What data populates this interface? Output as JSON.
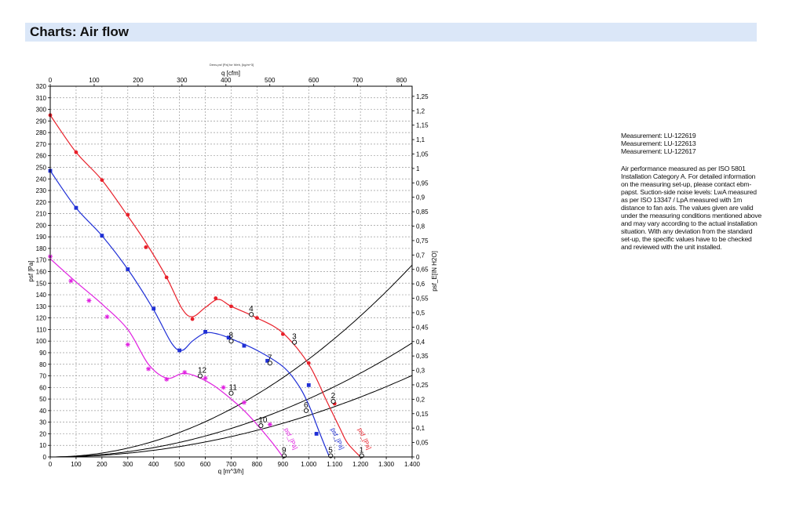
{
  "header": {
    "title": "Charts: Air flow"
  },
  "notes": {
    "measurements": [
      "Measurement: LU-122619",
      "Measurement: LU-122613",
      "Measurement: LU-122617"
    ],
    "description": "Air performance measured as per ISO 5801 Installation Category A. For detailed information on the measuring set-up, please contact ebm-papst. Suction-side noise levels: LwA measured as per ISO 13347 / LpA measured with 1m distance to fan axis. The values given are valid under the measuring conditions mentioned above and may vary according to the actual installation situation. With any deviation from the standard set-up, the specific values have to be checked and reviewed with the unit installed."
  },
  "colors": {
    "red": "#e8202a",
    "blue": "#1f2fd6",
    "magenta": "#e020e0",
    "system": "#000000",
    "grid": "#9a9a9a",
    "header_bg": "#dbe7f8"
  },
  "chart_data": {
    "type": "line",
    "title": "Dens.psf [Pa] for Weh, [kg/m^3]",
    "xlabel": "q [m^3/h]",
    "x_ticks": [
      "0",
      "100",
      "200",
      "300",
      "400",
      "500",
      "600",
      "700",
      "800",
      "900",
      "1.000",
      "1.100",
      "1.200",
      "1.300",
      "1.400"
    ],
    "xlim": [
      0,
      1400
    ],
    "x2label": "q [cfm]",
    "x2_ticks": [
      "0",
      "100",
      "200",
      "300",
      "400",
      "500",
      "600",
      "700",
      "800"
    ],
    "x2lim": [
      0,
      824
    ],
    "ylabel": "psf [Pa]",
    "ylim": [
      0,
      320
    ],
    "y_ticks": [
      "0",
      "10",
      "20",
      "30",
      "40",
      "50",
      "60",
      "70",
      "80",
      "90",
      "100",
      "110",
      "120",
      "130",
      "140",
      "150",
      "160",
      "170",
      "180",
      "190",
      "200",
      "210",
      "220",
      "230",
      "240",
      "250",
      "260",
      "270",
      "280",
      "290",
      "300",
      "310",
      "320"
    ],
    "y2label": "psf_E[IN H2O]",
    "y2lim": [
      0,
      1.285
    ],
    "y2_ticks": [
      "0",
      "0,05",
      "0,1",
      "0,15",
      "0,2",
      "0,25",
      "0,3",
      "0,35",
      "0,4",
      "0,45",
      "0,5",
      "0,55",
      "0,6",
      "0,65",
      "0,7",
      "0,75",
      "0,8",
      "0,85",
      "0,9",
      "0,95",
      "1",
      "1,05",
      "1,1",
      "1,15",
      "1,2",
      "1,25"
    ],
    "grid": true,
    "series": [
      {
        "name": "psf [Pa]",
        "color": "red",
        "marker": "circle",
        "x": [
          0,
          100,
          200,
          300,
          370,
          450,
          510,
          550,
          600,
          650,
          700,
          800,
          900,
          1000,
          1070,
          1120,
          1150,
          1200
        ],
        "y": [
          295,
          263,
          239,
          208,
          185,
          155,
          128,
          121,
          129,
          136,
          130,
          120,
          107,
          80,
          48,
          25,
          12,
          0
        ],
        "markers_x": [
          0,
          100,
          200,
          300,
          370,
          450,
          550,
          640,
          700,
          800,
          900,
          1000,
          1100
        ],
        "markers_y": [
          295,
          263,
          239,
          209,
          181,
          155,
          119,
          137,
          130,
          120,
          106,
          81,
          46
        ]
      },
      {
        "name": "psf [Pa]",
        "color": "blue",
        "marker": "square",
        "x": [
          0,
          100,
          200,
          300,
          400,
          470,
          510,
          550,
          600,
          650,
          700,
          800,
          900,
          960,
          1000,
          1040,
          1080
        ],
        "y": [
          247,
          215,
          191,
          162,
          127,
          98,
          92,
          100,
          107,
          106,
          102,
          92,
          78,
          62,
          45,
          22,
          0
        ],
        "markers_x": [
          0,
          100,
          200,
          300,
          400,
          500,
          600,
          690,
          750,
          840,
          1000,
          1030
        ],
        "markers_y": [
          247,
          215,
          191,
          162,
          128,
          92,
          108,
          103,
          96,
          83,
          62,
          20
        ]
      },
      {
        "name": "psf [Pa]",
        "color": "magenta",
        "marker": "star",
        "x": [
          0,
          100,
          200,
          300,
          380,
          450,
          510,
          560,
          630,
          700,
          750,
          800,
          860,
          900
        ],
        "y": [
          171,
          151,
          132,
          110,
          80,
          68,
          72,
          70,
          62,
          50,
          40,
          28,
          12,
          0
        ],
        "markers_x": [
          0,
          80,
          150,
          220,
          300,
          380,
          450,
          520,
          600,
          670,
          750,
          850
        ],
        "markers_y": [
          173,
          152,
          135,
          121,
          97,
          76,
          67,
          73,
          68,
          60,
          47,
          28
        ]
      }
    ],
    "system_curves": [
      {
        "k": 8.45e-05
      },
      {
        "k": 5.02e-05
      },
      {
        "k": 3.59e-05
      }
    ],
    "points": [
      {
        "label": "1",
        "x": 1205,
        "y": 1
      },
      {
        "label": "2",
        "x": 1095,
        "y": 48
      },
      {
        "label": "3",
        "x": 945,
        "y": 99
      },
      {
        "label": "4",
        "x": 778,
        "y": 123
      },
      {
        "label": "5",
        "x": 1085,
        "y": 1
      },
      {
        "label": "6",
        "x": 990,
        "y": 40
      },
      {
        "label": "7",
        "x": 850,
        "y": 81
      },
      {
        "label": "8",
        "x": 700,
        "y": 100
      },
      {
        "label": "9",
        "x": 905,
        "y": 1
      },
      {
        "label": "10",
        "x": 815,
        "y": 27
      },
      {
        "label": "11",
        "x": 700,
        "y": 55
      },
      {
        "label": "12",
        "x": 580,
        "y": 70
      }
    ],
    "curve_labels": [
      {
        "text": "psf_[Pa]",
        "color": "magenta",
        "x": 905,
        "y": 24
      },
      {
        "text": "psf_[Pa]",
        "color": "blue",
        "x": 1085,
        "y": 24
      },
      {
        "text": "psf_[Pa]",
        "color": "red",
        "x": 1190,
        "y": 24
      }
    ]
  }
}
